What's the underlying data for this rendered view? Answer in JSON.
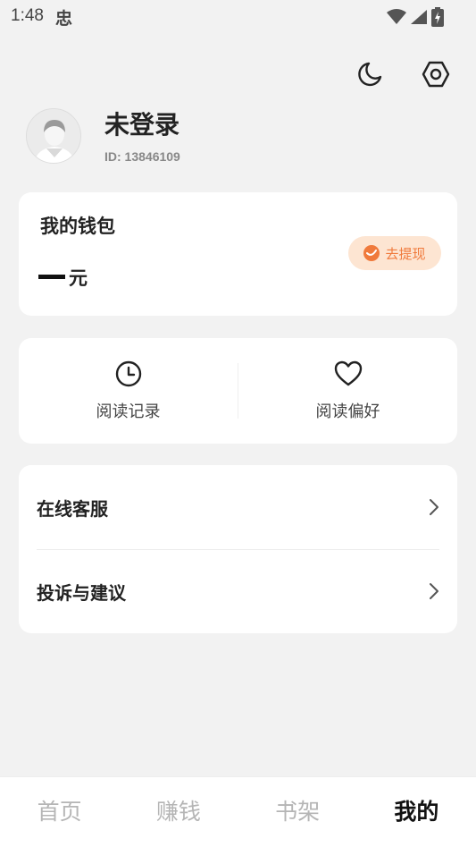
{
  "status_bar": {
    "time": "1:48",
    "app_glyph": "忠"
  },
  "top_actions": {
    "night_mode_icon": "moon-icon",
    "settings_icon": "hexagon-gear-icon"
  },
  "profile": {
    "name": "未登录",
    "id_text": "ID: 13846109"
  },
  "wallet": {
    "title": "我的钱包",
    "amount_placeholder": "—",
    "unit": "元",
    "withdraw_label": "去提现",
    "accent": "#f07a3c"
  },
  "reading": {
    "items": [
      {
        "label": "阅读记录",
        "icon": "clock-icon"
      },
      {
        "label": "阅读偏好",
        "icon": "heart-icon"
      }
    ]
  },
  "service": {
    "items": [
      {
        "label": "在线客服"
      },
      {
        "label": "投诉与建议"
      }
    ]
  },
  "bottom_nav": {
    "items": [
      {
        "label": "首页"
      },
      {
        "label": "赚钱"
      },
      {
        "label": "书架"
      },
      {
        "label": "我的"
      }
    ],
    "active_index": 3
  }
}
